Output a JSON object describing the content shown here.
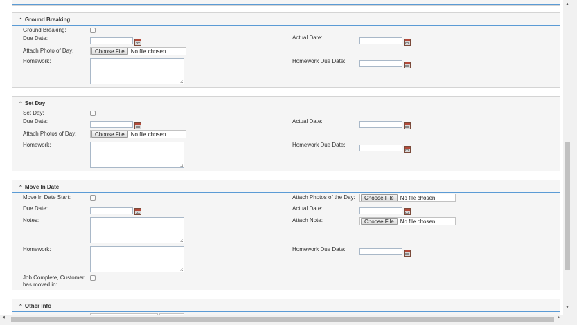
{
  "sections": {
    "ground_breaking": {
      "title": "Ground Breaking",
      "labels": {
        "ground_breaking": "Ground Breaking:",
        "due_date": "Due Date:",
        "actual_date": "Actual Date:",
        "attach_photo": "Attach Photo of Day:",
        "homework": "Homework:",
        "homework_due_date": "Homework Due Date:"
      }
    },
    "set_day": {
      "title": "Set Day",
      "labels": {
        "set_day": "Set Day:",
        "due_date": "Due Date:",
        "actual_date": "Actual Date:",
        "attach_photos": "Attach Photos of Day:",
        "homework": "Homework:",
        "homework_due_date": "Homework Due Date:"
      }
    },
    "move_in_date": {
      "title": "Move In Date",
      "labels": {
        "move_in_start": "Move In Date Start:",
        "attach_photos_day": "Attach Photos of the Day:",
        "due_date": "Due Date:",
        "actual_date": "Actual Date:",
        "notes": "Notes:",
        "attach_note": "Attach Note:",
        "homework": "Homework:",
        "homework_due_date": "Homework Due Date:",
        "job_complete_line1": "Job Complete, Customer",
        "job_complete_line2": "has moved in:"
      }
    },
    "other_info": {
      "title": "Other Info"
    }
  },
  "file_input": {
    "button_label": "Choose File",
    "status": "No file chosen"
  },
  "icons": {
    "section_toggle": "chevron-up-double-icon",
    "calendar": "calendar-icon"
  },
  "colors": {
    "accent_rule": "#5b9bd5",
    "panel_bg": "#f5f5f5"
  }
}
